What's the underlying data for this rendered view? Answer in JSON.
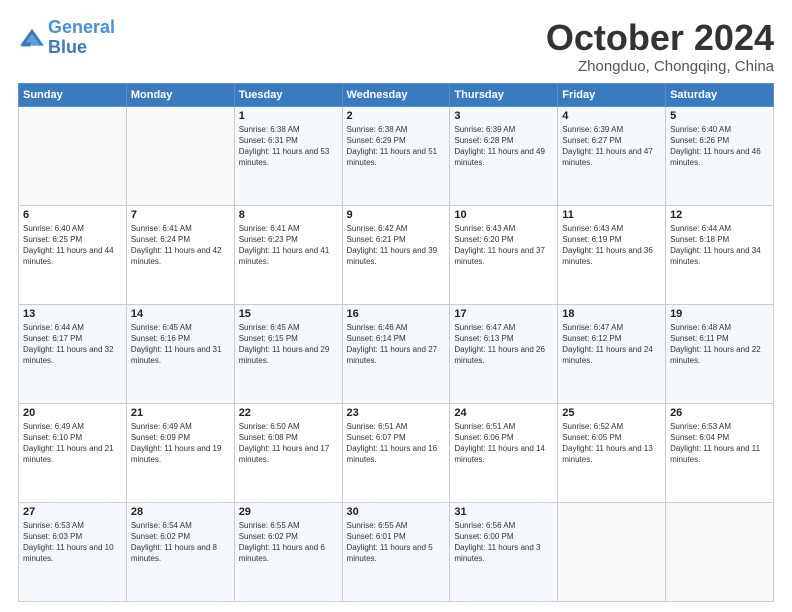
{
  "header": {
    "logo_line1": "General",
    "logo_line2": "Blue",
    "month_title": "October 2024",
    "subtitle": "Zhongduo, Chongqing, China"
  },
  "weekdays": [
    "Sunday",
    "Monday",
    "Tuesday",
    "Wednesday",
    "Thursday",
    "Friday",
    "Saturday"
  ],
  "weeks": [
    [
      {
        "day": "",
        "sunrise": "",
        "sunset": "",
        "daylight": ""
      },
      {
        "day": "",
        "sunrise": "",
        "sunset": "",
        "daylight": ""
      },
      {
        "day": "1",
        "sunrise": "Sunrise: 6:38 AM",
        "sunset": "Sunset: 6:31 PM",
        "daylight": "Daylight: 11 hours and 53 minutes."
      },
      {
        "day": "2",
        "sunrise": "Sunrise: 6:38 AM",
        "sunset": "Sunset: 6:29 PM",
        "daylight": "Daylight: 11 hours and 51 minutes."
      },
      {
        "day": "3",
        "sunrise": "Sunrise: 6:39 AM",
        "sunset": "Sunset: 6:28 PM",
        "daylight": "Daylight: 11 hours and 49 minutes."
      },
      {
        "day": "4",
        "sunrise": "Sunrise: 6:39 AM",
        "sunset": "Sunset: 6:27 PM",
        "daylight": "Daylight: 11 hours and 47 minutes."
      },
      {
        "day": "5",
        "sunrise": "Sunrise: 6:40 AM",
        "sunset": "Sunset: 6:26 PM",
        "daylight": "Daylight: 11 hours and 46 minutes."
      }
    ],
    [
      {
        "day": "6",
        "sunrise": "Sunrise: 6:40 AM",
        "sunset": "Sunset: 6:25 PM",
        "daylight": "Daylight: 11 hours and 44 minutes."
      },
      {
        "day": "7",
        "sunrise": "Sunrise: 6:41 AM",
        "sunset": "Sunset: 6:24 PM",
        "daylight": "Daylight: 11 hours and 42 minutes."
      },
      {
        "day": "8",
        "sunrise": "Sunrise: 6:41 AM",
        "sunset": "Sunset: 6:23 PM",
        "daylight": "Daylight: 11 hours and 41 minutes."
      },
      {
        "day": "9",
        "sunrise": "Sunrise: 6:42 AM",
        "sunset": "Sunset: 6:21 PM",
        "daylight": "Daylight: 11 hours and 39 minutes."
      },
      {
        "day": "10",
        "sunrise": "Sunrise: 6:43 AM",
        "sunset": "Sunset: 6:20 PM",
        "daylight": "Daylight: 11 hours and 37 minutes."
      },
      {
        "day": "11",
        "sunrise": "Sunrise: 6:43 AM",
        "sunset": "Sunset: 6:19 PM",
        "daylight": "Daylight: 11 hours and 36 minutes."
      },
      {
        "day": "12",
        "sunrise": "Sunrise: 6:44 AM",
        "sunset": "Sunset: 6:18 PM",
        "daylight": "Daylight: 11 hours and 34 minutes."
      }
    ],
    [
      {
        "day": "13",
        "sunrise": "Sunrise: 6:44 AM",
        "sunset": "Sunset: 6:17 PM",
        "daylight": "Daylight: 11 hours and 32 minutes."
      },
      {
        "day": "14",
        "sunrise": "Sunrise: 6:45 AM",
        "sunset": "Sunset: 6:16 PM",
        "daylight": "Daylight: 11 hours and 31 minutes."
      },
      {
        "day": "15",
        "sunrise": "Sunrise: 6:45 AM",
        "sunset": "Sunset: 6:15 PM",
        "daylight": "Daylight: 11 hours and 29 minutes."
      },
      {
        "day": "16",
        "sunrise": "Sunrise: 6:46 AM",
        "sunset": "Sunset: 6:14 PM",
        "daylight": "Daylight: 11 hours and 27 minutes."
      },
      {
        "day": "17",
        "sunrise": "Sunrise: 6:47 AM",
        "sunset": "Sunset: 6:13 PM",
        "daylight": "Daylight: 11 hours and 26 minutes."
      },
      {
        "day": "18",
        "sunrise": "Sunrise: 6:47 AM",
        "sunset": "Sunset: 6:12 PM",
        "daylight": "Daylight: 11 hours and 24 minutes."
      },
      {
        "day": "19",
        "sunrise": "Sunrise: 6:48 AM",
        "sunset": "Sunset: 6:11 PM",
        "daylight": "Daylight: 11 hours and 22 minutes."
      }
    ],
    [
      {
        "day": "20",
        "sunrise": "Sunrise: 6:49 AM",
        "sunset": "Sunset: 6:10 PM",
        "daylight": "Daylight: 11 hours and 21 minutes."
      },
      {
        "day": "21",
        "sunrise": "Sunrise: 6:49 AM",
        "sunset": "Sunset: 6:09 PM",
        "daylight": "Daylight: 11 hours and 19 minutes."
      },
      {
        "day": "22",
        "sunrise": "Sunrise: 6:50 AM",
        "sunset": "Sunset: 6:08 PM",
        "daylight": "Daylight: 11 hours and 17 minutes."
      },
      {
        "day": "23",
        "sunrise": "Sunrise: 6:51 AM",
        "sunset": "Sunset: 6:07 PM",
        "daylight": "Daylight: 11 hours and 16 minutes."
      },
      {
        "day": "24",
        "sunrise": "Sunrise: 6:51 AM",
        "sunset": "Sunset: 6:06 PM",
        "daylight": "Daylight: 11 hours and 14 minutes."
      },
      {
        "day": "25",
        "sunrise": "Sunrise: 6:52 AM",
        "sunset": "Sunset: 6:05 PM",
        "daylight": "Daylight: 11 hours and 13 minutes."
      },
      {
        "day": "26",
        "sunrise": "Sunrise: 6:53 AM",
        "sunset": "Sunset: 6:04 PM",
        "daylight": "Daylight: 11 hours and 11 minutes."
      }
    ],
    [
      {
        "day": "27",
        "sunrise": "Sunrise: 6:53 AM",
        "sunset": "Sunset: 6:03 PM",
        "daylight": "Daylight: 11 hours and 10 minutes."
      },
      {
        "day": "28",
        "sunrise": "Sunrise: 6:54 AM",
        "sunset": "Sunset: 6:02 PM",
        "daylight": "Daylight: 11 hours and 8 minutes."
      },
      {
        "day": "29",
        "sunrise": "Sunrise: 6:55 AM",
        "sunset": "Sunset: 6:02 PM",
        "daylight": "Daylight: 11 hours and 6 minutes."
      },
      {
        "day": "30",
        "sunrise": "Sunrise: 6:55 AM",
        "sunset": "Sunset: 6:01 PM",
        "daylight": "Daylight: 11 hours and 5 minutes."
      },
      {
        "day": "31",
        "sunrise": "Sunrise: 6:56 AM",
        "sunset": "Sunset: 6:00 PM",
        "daylight": "Daylight: 11 hours and 3 minutes."
      },
      {
        "day": "",
        "sunrise": "",
        "sunset": "",
        "daylight": ""
      },
      {
        "day": "",
        "sunrise": "",
        "sunset": "",
        "daylight": ""
      }
    ]
  ]
}
